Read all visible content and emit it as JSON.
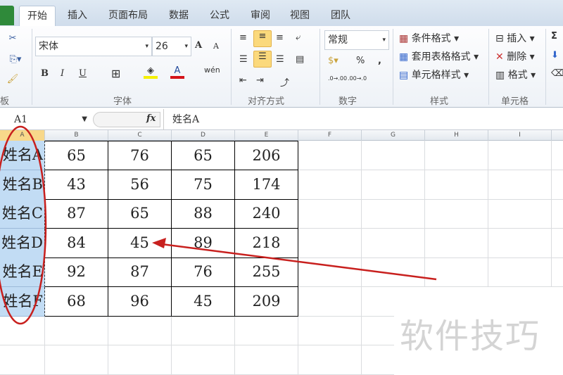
{
  "tabs": [
    "开始",
    "插入",
    "页面布局",
    "数据",
    "公式",
    "审阅",
    "视图",
    "团队"
  ],
  "ribbon": {
    "clipboard_label": "板",
    "font_label": "字体",
    "font_name": "宋体",
    "font_size": "26",
    "bold": "B",
    "italic": "I",
    "underline": "U",
    "grow": "A",
    "shrink": "A",
    "phonetic": "wén",
    "align_label": "对齐方式",
    "number_label": "数字",
    "number_format": "常规",
    "percent": "%",
    "comma": ",",
    "inc_decimal": ".0→.00",
    "dec_decimal": ".00→.0",
    "styles_label": "样式",
    "conditional": "条件格式",
    "table_format": "套用表格格式",
    "cell_styles": "单元格样式",
    "cells_label": "单元格",
    "insert": "插入",
    "delete": "删除",
    "format": "格式",
    "sum": "Σ"
  },
  "formula_bar": {
    "name_box": "A1",
    "fx": "fx",
    "value": "姓名A"
  },
  "columns": [
    "A",
    "B",
    "C",
    "D",
    "E",
    "F",
    "G",
    "H",
    "I"
  ],
  "rows": [
    [
      "姓名A",
      "65",
      "76",
      "65",
      "206"
    ],
    [
      "姓名B",
      "43",
      "56",
      "75",
      "174"
    ],
    [
      "姓名C",
      "87",
      "65",
      "88",
      "240"
    ],
    [
      "姓名D",
      "84",
      "45",
      "89",
      "218"
    ],
    [
      "姓名E",
      "92",
      "87",
      "76",
      "255"
    ],
    [
      "姓名F",
      "68",
      "96",
      "45",
      "209"
    ]
  ],
  "watermark": "软件技巧",
  "annotation_color": "#c8201e"
}
